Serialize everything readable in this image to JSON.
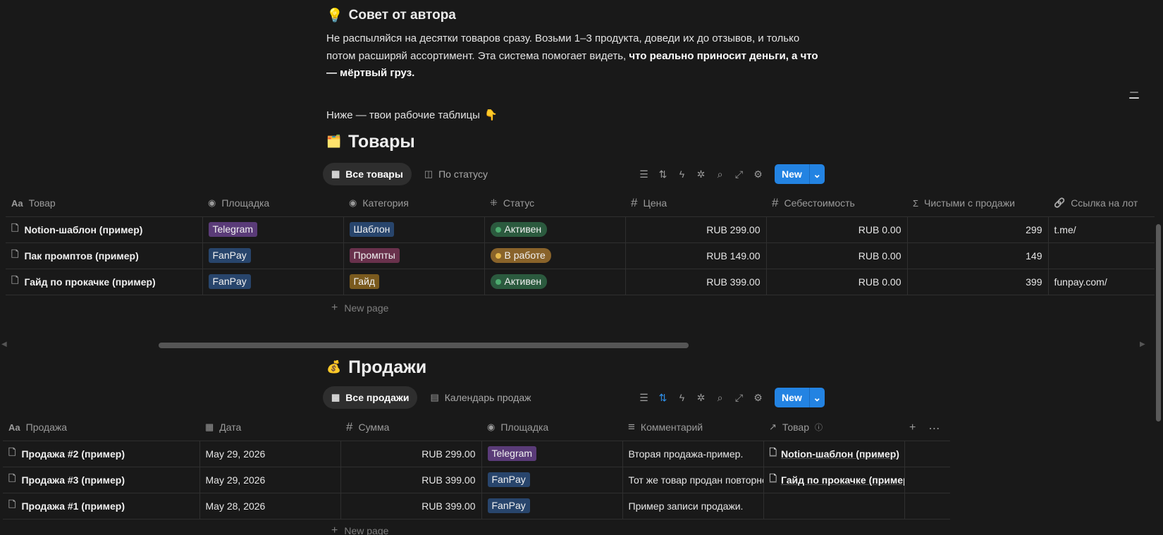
{
  "callout": {
    "icon": "lightbulb-icon",
    "emoji": "💡",
    "title": "Совет от автора",
    "text_1": "Не распыляйся на десятки товаров сразу. Возьми 1–3 продукта, доведи их до отзывов, и только потом расширяй ассортимент. Эта система помогает видеть, ",
    "text_bold": "что реально приносит деньги, а что — мёртвый груз.",
    "below_text": "Ниже — твои рабочие таблицы",
    "below_emoji": "👇"
  },
  "products": {
    "emoji": "🗂️",
    "title": "Товары",
    "views": [
      {
        "label": "Все товары",
        "icon": "table-icon",
        "active": true
      },
      {
        "label": "По статусу",
        "icon": "board-icon",
        "active": false
      }
    ],
    "new_label": "New",
    "columns": [
      {
        "label": "Товар",
        "icon": "text-icon",
        "glyph": "Aa"
      },
      {
        "label": "Площадка",
        "icon": "select-icon",
        "glyph": "◉"
      },
      {
        "label": "Категория",
        "icon": "select-icon",
        "glyph": "◉"
      },
      {
        "label": "Статус",
        "icon": "status-icon",
        "glyph": "⁜"
      },
      {
        "label": "Цена",
        "icon": "number-icon",
        "glyph": "#"
      },
      {
        "label": "Себестоимость",
        "icon": "number-icon",
        "glyph": "#"
      },
      {
        "label": "Чистыми с продажи",
        "icon": "formula-icon",
        "glyph": "Σ"
      },
      {
        "label": "Ссылка на лот",
        "icon": "link-icon",
        "glyph": "🔗"
      }
    ],
    "rows": [
      {
        "name": "Notion-шаблон (пример)",
        "platform": "Telegram",
        "category": "Шаблон",
        "status": "Активен",
        "price": "RUB 299.00",
        "cost": "RUB 0.00",
        "net": "299",
        "link": "t.me/"
      },
      {
        "name": "Пак промптов (пример)",
        "platform": "FanPay",
        "category": "Промпты",
        "status": "В работе",
        "price": "RUB 149.00",
        "cost": "RUB 0.00",
        "net": "149",
        "link": ""
      },
      {
        "name": "Гайд по прокачке (пример)",
        "platform": "FanPay",
        "category": "Гайд",
        "status": "Активен",
        "price": "RUB 399.00",
        "cost": "RUB 0.00",
        "net": "399",
        "link": "funpay.com/"
      }
    ],
    "new_page_label": "New page"
  },
  "sales": {
    "emoji": "💰",
    "title": "Продажи",
    "views": [
      {
        "label": "Все продажи",
        "icon": "table-icon",
        "active": true
      },
      {
        "label": "Календарь продаж",
        "icon": "calendar-icon",
        "active": false
      }
    ],
    "new_label": "New",
    "columns": [
      {
        "label": "Продажа",
        "icon": "text-icon",
        "glyph": "Aa"
      },
      {
        "label": "Дата",
        "icon": "calendar-icon",
        "glyph": "▦"
      },
      {
        "label": "Сумма",
        "icon": "number-icon",
        "glyph": "#"
      },
      {
        "label": "Площадка",
        "icon": "select-icon",
        "glyph": "◉"
      },
      {
        "label": "Комментарий",
        "icon": "text-lines-icon",
        "glyph": "≡"
      },
      {
        "label": "Товар",
        "icon": "relation-icon",
        "glyph": "↗"
      }
    ],
    "rows": [
      {
        "name": "Продажа #2 (пример)",
        "date": "May 29, 2026",
        "amount": "RUB 299.00",
        "platform": "Telegram",
        "comment": "Вторая продажа-пример.",
        "product": "Notion-шаблон (пример)"
      },
      {
        "name": "Продажа #3 (пример)",
        "date": "May 29, 2026",
        "amount": "RUB 399.00",
        "platform": "FanPay",
        "comment": "Тот же товар продан повторно",
        "product": "Гайд по прокачке (пример)"
      },
      {
        "name": "Продажа #1 (пример)",
        "date": "May 28, 2026",
        "amount": "RUB 399.00",
        "platform": "FanPay",
        "comment": "Пример записи продажи.",
        "product": ""
      }
    ],
    "new_page_label": "New page"
  },
  "colors": {
    "Telegram": "#5a3b78",
    "FanPay": "#28456c",
    "Шаблон": "#28456c",
    "Промпты": "#69314c",
    "Гайд": "#7a5a1e",
    "Активен": "#2b5a3e",
    "Активен_dot": "#4dab6f",
    "В работе": "#89632a",
    "В работе_dot": "#e5b84b",
    "accent": "#2383e2"
  }
}
